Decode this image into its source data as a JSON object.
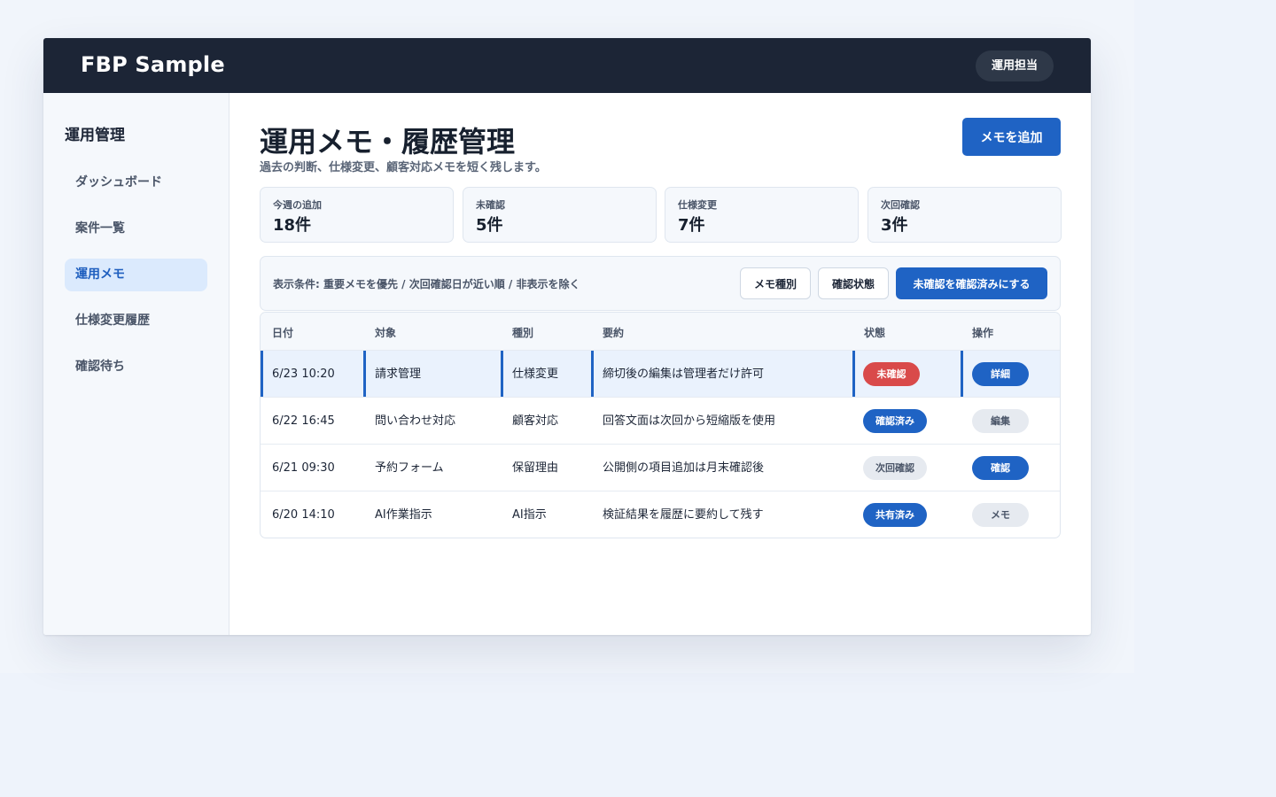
{
  "app": {
    "brand": "FBP Sample",
    "role_label": "運用担当"
  },
  "sidebar": {
    "title": "運用管理",
    "items": [
      {
        "label": "ダッシュボード",
        "active": false
      },
      {
        "label": "案件一覧",
        "active": false
      },
      {
        "label": "運用メモ",
        "active": true
      },
      {
        "label": "仕様変更履歴",
        "active": false
      },
      {
        "label": "確認待ち",
        "active": false
      }
    ]
  },
  "page": {
    "title": "運用メモ・履歴管理",
    "subtitle": "過去の判断、仕様変更、顧客対応メモを短く残します。",
    "add_button": "メモを追加"
  },
  "stats": [
    {
      "label": "今週の追加",
      "value": "18件"
    },
    {
      "label": "未確認",
      "value": "5件"
    },
    {
      "label": "仕様変更",
      "value": "7件"
    },
    {
      "label": "次回確認",
      "value": "3件"
    }
  ],
  "filter": {
    "text": "表示条件: 重要メモを優先 / 次回確認日が近い順 / 非表示を除く",
    "type_button": "メモ種別",
    "status_button": "確認状態",
    "bulk_button": "未確認を確認済みにする"
  },
  "table": {
    "headers": [
      "日付",
      "対象",
      "種別",
      "要約",
      "状態",
      "操作"
    ],
    "rows": [
      {
        "date": "6/23 10:20",
        "target": "請求管理",
        "type": "仕様変更",
        "summary": "締切後の編集は管理者だけ許可",
        "status": "未確認",
        "status_color": "#d94a4a",
        "action": "詳細",
        "action_style": "primary",
        "highlight": true
      },
      {
        "date": "6/22 16:45",
        "target": "問い合わせ対応",
        "type": "顧客対応",
        "summary": "回答文面は次回から短縮版を使用",
        "status": "確認済み",
        "status_color": "#1f63c4",
        "action": "編集",
        "action_style": "secondary",
        "highlight": false
      },
      {
        "date": "6/21 09:30",
        "target": "予約フォーム",
        "type": "保留理由",
        "summary": "公開側の項目追加は月末確認後",
        "status": "次回確認",
        "status_color": "#e6eaf0",
        "action": "確認",
        "action_style": "primary",
        "highlight": false
      },
      {
        "date": "6/20 14:10",
        "target": "AI作業指示",
        "type": "AI指示",
        "summary": "検証結果を履歴に要約して残す",
        "status": "共有済み",
        "status_color": "#1f63c4",
        "action": "メモ",
        "action_style": "secondary",
        "highlight": false
      }
    ]
  }
}
